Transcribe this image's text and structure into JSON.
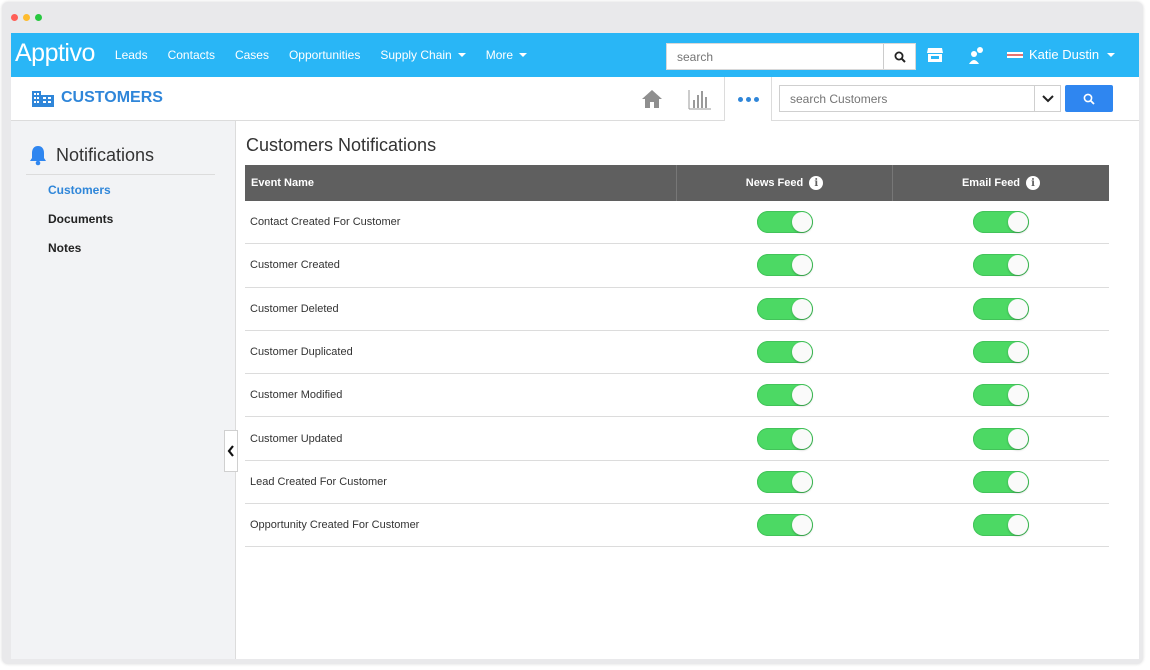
{
  "window": {
    "dot_colors": [
      "#ff5f57",
      "#febc2e",
      "#28c840"
    ]
  },
  "topnav": {
    "logo": "Apptivo",
    "items": [
      {
        "label": "Leads",
        "dropdown": false
      },
      {
        "label": "Contacts",
        "dropdown": false
      },
      {
        "label": "Cases",
        "dropdown": false
      },
      {
        "label": "Opportunities",
        "dropdown": false
      },
      {
        "label": "Supply Chain",
        "dropdown": true
      },
      {
        "label": "More",
        "dropdown": true
      }
    ],
    "search_placeholder": "search",
    "user_name": "Katie Dustin",
    "accent_color": "#29b6f6"
  },
  "subheader": {
    "module_title": "CUSTOMERS",
    "search_placeholder": "search Customers"
  },
  "sidebar": {
    "title": "Notifications",
    "items": [
      {
        "label": "Customers",
        "active": true
      },
      {
        "label": "Documents",
        "active": false
      },
      {
        "label": "Notes",
        "active": false
      }
    ]
  },
  "main": {
    "title": "Customers Notifications",
    "columns": {
      "event_name": "Event Name",
      "news_feed": "News Feed",
      "email_feed": "Email Feed"
    },
    "rows": [
      {
        "event": "Contact Created For Customer",
        "news_feed": true,
        "email_feed": true
      },
      {
        "event": "Customer Created",
        "news_feed": true,
        "email_feed": true
      },
      {
        "event": "Customer Deleted",
        "news_feed": true,
        "email_feed": true
      },
      {
        "event": "Customer Duplicated",
        "news_feed": true,
        "email_feed": true
      },
      {
        "event": "Customer Modified",
        "news_feed": true,
        "email_feed": true
      },
      {
        "event": "Customer Updated",
        "news_feed": true,
        "email_feed": true
      },
      {
        "event": "Lead Created For Customer",
        "news_feed": true,
        "email_feed": true
      },
      {
        "event": "Opportunity Created For Customer",
        "news_feed": true,
        "email_feed": true
      }
    ],
    "toggle_on_color": "#4cd964"
  }
}
